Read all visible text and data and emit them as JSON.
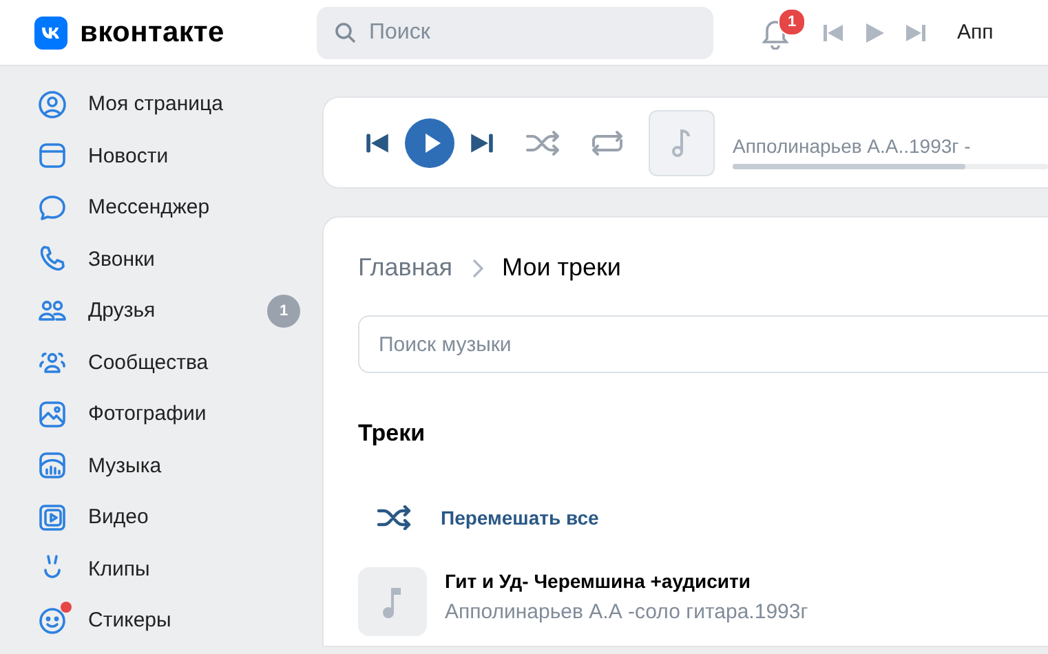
{
  "header": {
    "logo": "вконтакте",
    "search": {
      "placeholder": "Поиск"
    },
    "notifications": "1",
    "now_playing": "Апп"
  },
  "sidebar": {
    "items": [
      {
        "label": "Моя страница",
        "dot": false
      },
      {
        "label": "Новости",
        "dot": false
      },
      {
        "label": "Мессенджер",
        "dot": false
      },
      {
        "label": "Звонки",
        "dot": false
      },
      {
        "label": "Друзья",
        "badge": "1",
        "dot": false
      },
      {
        "label": "Сообщества",
        "dot": false
      },
      {
        "label": "Фотографии",
        "dot": false
      },
      {
        "label": "Музыка",
        "dot": false
      },
      {
        "label": "Видео",
        "dot": false
      },
      {
        "label": "Клипы",
        "dot": false
      },
      {
        "label": "Стикеры",
        "dot": true
      }
    ]
  },
  "player": {
    "title": "Апполинарьев А.А..1993г -",
    "level": 0.74
  },
  "breadcrumbs": [
    {
      "label": "Главная",
      "selected": false
    },
    {
      "label": "Мои треки",
      "selected": true
    }
  ],
  "music_search": {
    "placeholder": "Поиск музыки"
  },
  "section_title": "Треки",
  "shuffle_all": "Перемешать все",
  "tracks": [
    {
      "title": "Гит и Уд- Черемшина +аудисити",
      "artist": "Апполинарьев А.А -соло гитара.1993г"
    }
  ]
}
